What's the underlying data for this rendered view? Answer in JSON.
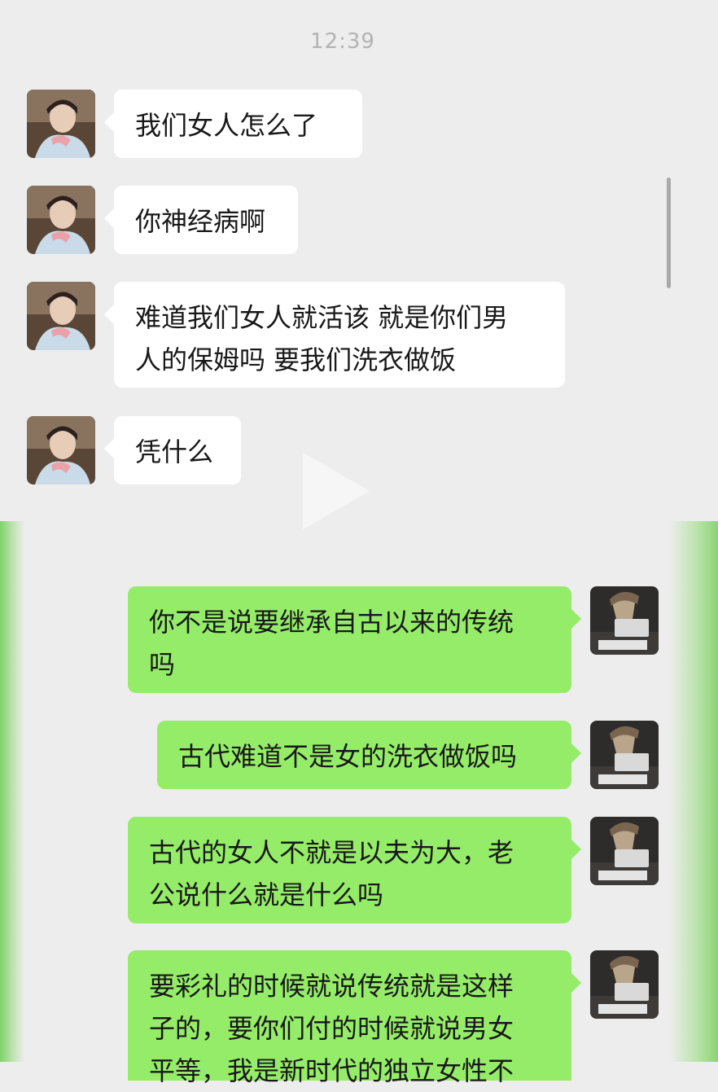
{
  "header": {
    "time": "12:39"
  },
  "messages": [
    {
      "side": "incoming",
      "lines": [
        "我们女人怎么了"
      ]
    },
    {
      "side": "incoming",
      "lines": [
        "你神经病啊"
      ]
    },
    {
      "side": "incoming",
      "lines": [
        "难道我们女人就活该 就是你们男",
        "人的保姆吗 要我们洗衣做饭"
      ]
    },
    {
      "side": "incoming",
      "lines": [
        "凭什么"
      ]
    },
    {
      "side": "outgoing",
      "lines": [
        "你不是说要继承自古以来的传统",
        "吗"
      ]
    },
    {
      "side": "outgoing",
      "lines": [
        "古代难道不是女的洗衣做饭吗"
      ]
    },
    {
      "side": "outgoing",
      "lines": [
        "古代的女人不就是以夫为大，老",
        "公说什么就是什么吗"
      ]
    },
    {
      "side": "outgoing",
      "lines": [
        "要彩礼的时候就说传统就是这样",
        "子的，要你们付的时候就说男女",
        "平等，我是新时代的独立女性不"
      ]
    }
  ],
  "colors": {
    "background": "#ededed",
    "incoming_bubble": "#ffffff",
    "outgoing_bubble": "#95ec69",
    "time_text": "#b3b3b3"
  },
  "icons": {
    "incoming_avatar": "contact-avatar-photo",
    "outgoing_avatar": "own-avatar-photo",
    "overlay": "play-icon"
  }
}
